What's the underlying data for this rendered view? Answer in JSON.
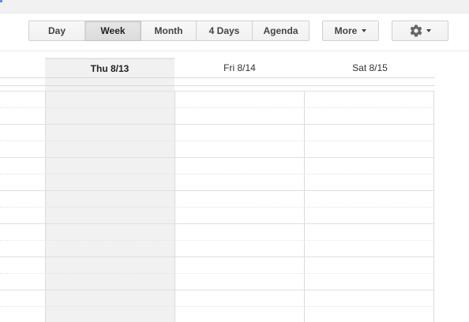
{
  "toolbar": {
    "views": [
      {
        "label": "Day",
        "selected": false
      },
      {
        "label": "Week",
        "selected": true
      },
      {
        "label": "Month",
        "selected": false
      },
      {
        "label": "4 Days",
        "selected": false
      },
      {
        "label": "Agenda",
        "selected": false
      }
    ],
    "more_label": "More",
    "settings_icon": "gear-icon"
  },
  "calendar": {
    "days": [
      {
        "label": "Thu 8/13",
        "today": true
      },
      {
        "label": "Fri 8/14",
        "today": false
      },
      {
        "label": "Sat 8/15",
        "today": false
      }
    ]
  },
  "colors": {
    "today_shade": "#f1f1f1",
    "grid_line": "#dadada",
    "accent": "#4d90fe"
  }
}
